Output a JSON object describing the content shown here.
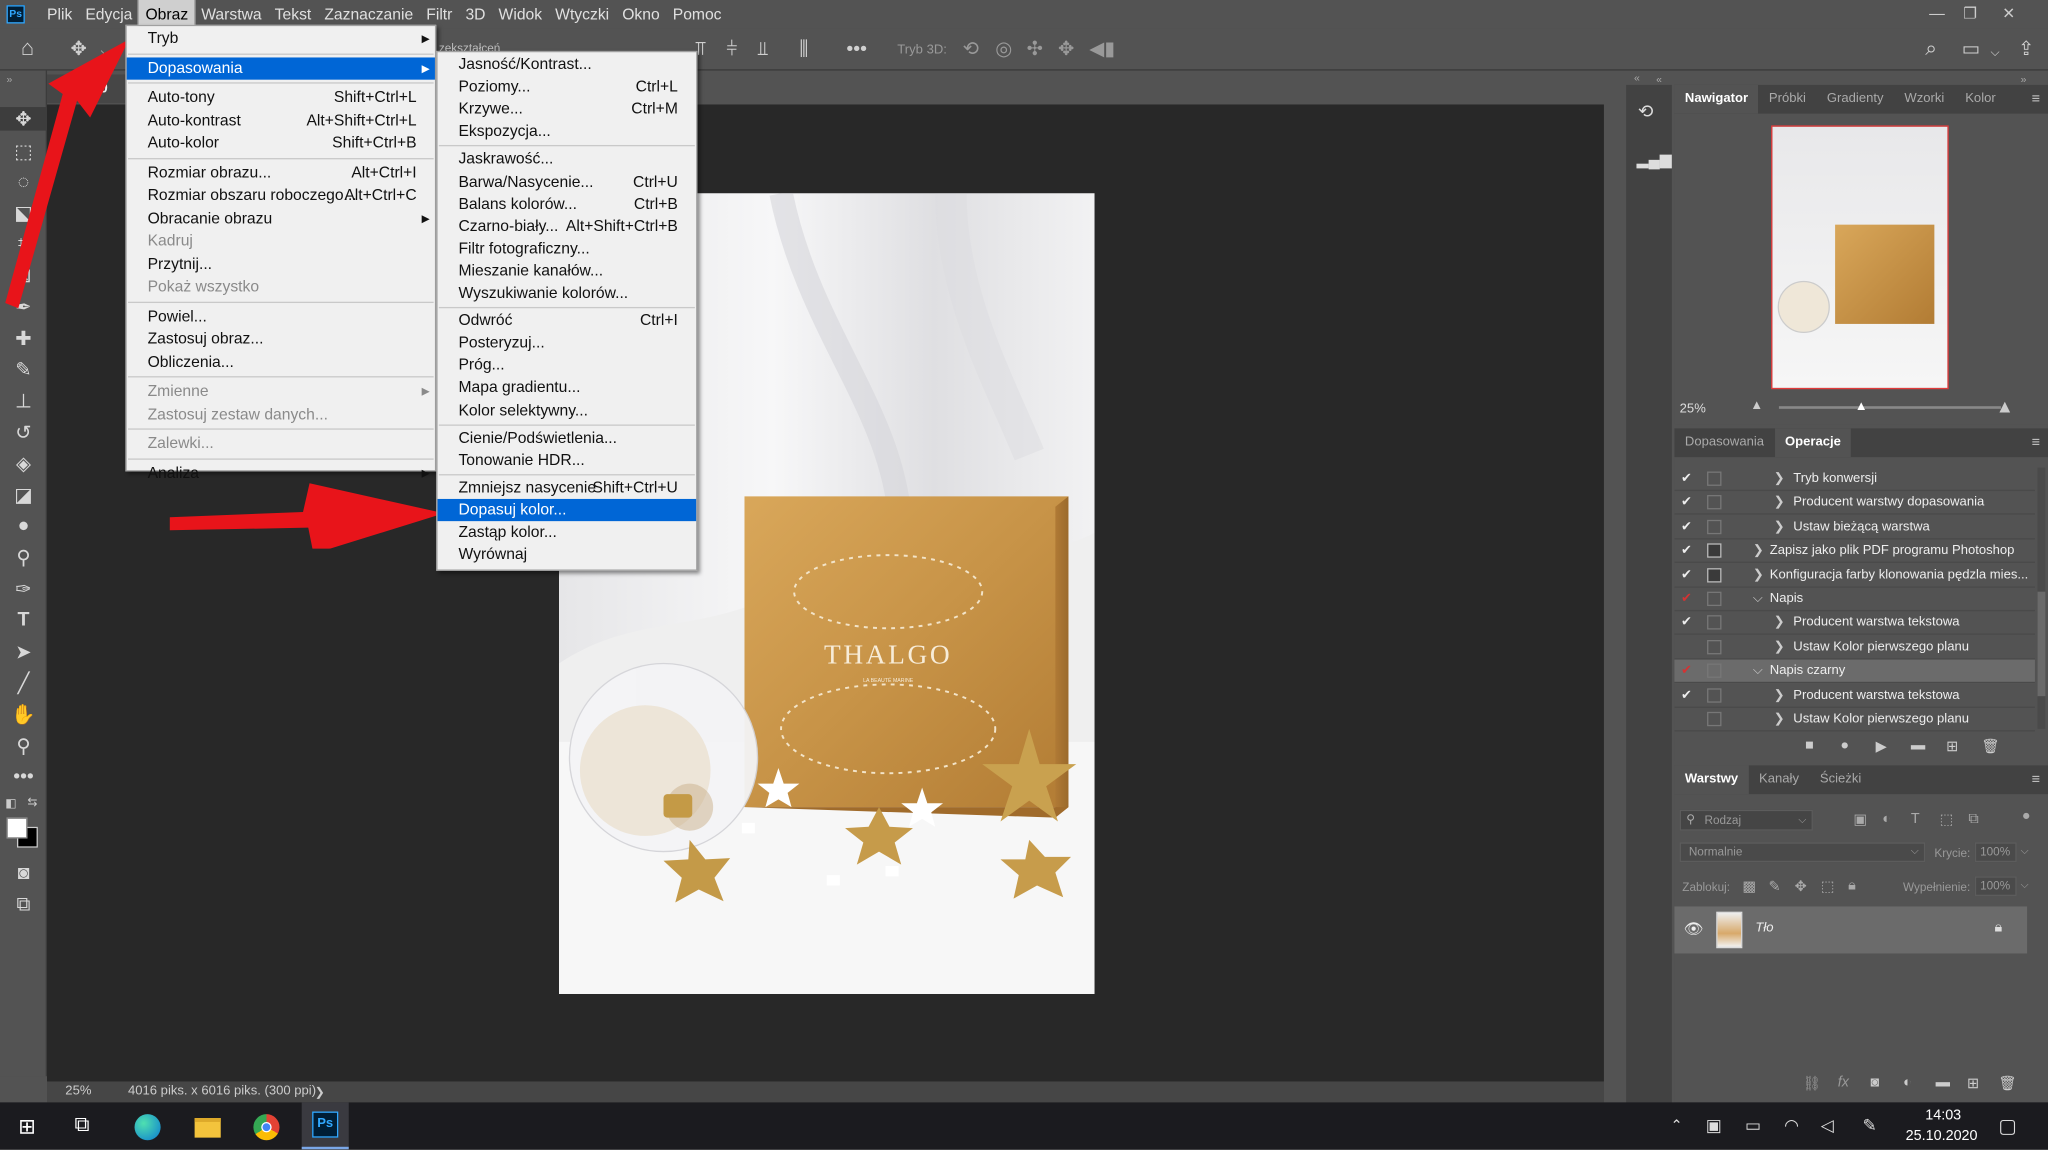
{
  "menubar": {
    "ps_logo": "Ps",
    "items": [
      "Plik",
      "Edycja",
      "Obraz",
      "Warstwa",
      "Tekst",
      "Zaznaczanie",
      "Filtr",
      "3D",
      "Widok",
      "Wtyczki",
      "Okno",
      "Pomoc"
    ],
    "active": "Obraz",
    "window_controls": [
      "—",
      "❐",
      "✕"
    ]
  },
  "optbar": {
    "partial_text": "zekształceń",
    "mode_3d_label": "Tryb 3D:"
  },
  "document": {
    "tab": "DSC_0",
    "zoom": "25%",
    "info": "4016 piks. x 6016 piks. (300 ppi)",
    "info_arrow": "❯",
    "brand": "THALGO",
    "brand_sub": "LA BEAUTÉ MARINE"
  },
  "obraz_menu": [
    {
      "label": "Tryb",
      "shortcut": "",
      "sub": true,
      "state": "normal"
    },
    {
      "sep": true
    },
    {
      "label": "Dopasowania",
      "shortcut": "",
      "sub": true,
      "state": "hl"
    },
    {
      "sep": true
    },
    {
      "label": "Auto-tony",
      "shortcut": "Shift+Ctrl+L",
      "state": "normal"
    },
    {
      "label": "Auto-kontrast",
      "shortcut": "Alt+Shift+Ctrl+L",
      "state": "normal"
    },
    {
      "label": "Auto-kolor",
      "shortcut": "Shift+Ctrl+B",
      "state": "normal"
    },
    {
      "sep": true
    },
    {
      "label": "Rozmiar obrazu...",
      "shortcut": "Alt+Ctrl+I",
      "state": "normal"
    },
    {
      "label": "Rozmiar obszaru roboczego...",
      "shortcut": "Alt+Ctrl+C",
      "state": "normal"
    },
    {
      "label": "Obracanie obrazu",
      "shortcut": "",
      "sub": true,
      "state": "normal"
    },
    {
      "label": "Kadruj",
      "shortcut": "",
      "state": "dis"
    },
    {
      "label": "Przytnij...",
      "shortcut": "",
      "state": "normal"
    },
    {
      "label": "Pokaż wszystko",
      "shortcut": "",
      "state": "dis"
    },
    {
      "sep": true
    },
    {
      "label": "Powiel...",
      "shortcut": "",
      "state": "normal"
    },
    {
      "label": "Zastosuj obraz...",
      "shortcut": "",
      "state": "normal"
    },
    {
      "label": "Obliczenia...",
      "shortcut": "",
      "state": "normal"
    },
    {
      "sep": true
    },
    {
      "label": "Zmienne",
      "shortcut": "",
      "sub": true,
      "state": "dis"
    },
    {
      "label": "Zastosuj zestaw danych...",
      "shortcut": "",
      "state": "dis"
    },
    {
      "sep": true
    },
    {
      "label": "Zalewki...",
      "shortcut": "",
      "state": "dis"
    },
    {
      "sep": true
    },
    {
      "label": "Analiza",
      "shortcut": "",
      "sub": true,
      "state": "normal"
    }
  ],
  "dopasowania_menu": [
    {
      "label": "Jasność/Kontrast...",
      "shortcut": "",
      "state": "normal"
    },
    {
      "label": "Poziomy...",
      "shortcut": "Ctrl+L",
      "state": "normal"
    },
    {
      "label": "Krzywe...",
      "shortcut": "Ctrl+M",
      "state": "normal"
    },
    {
      "label": "Ekspozycja...",
      "shortcut": "",
      "state": "normal"
    },
    {
      "sep": true
    },
    {
      "label": "Jaskrawość...",
      "shortcut": "",
      "state": "normal"
    },
    {
      "label": "Barwa/Nasycenie...",
      "shortcut": "Ctrl+U",
      "state": "normal"
    },
    {
      "label": "Balans kolorów...",
      "shortcut": "Ctrl+B",
      "state": "normal"
    },
    {
      "label": "Czarno-biały...",
      "shortcut": "Alt+Shift+Ctrl+B",
      "state": "normal"
    },
    {
      "label": "Filtr fotograficzny...",
      "shortcut": "",
      "state": "normal"
    },
    {
      "label": "Mieszanie kanałów...",
      "shortcut": "",
      "state": "normal"
    },
    {
      "label": "Wyszukiwanie kolorów...",
      "shortcut": "",
      "state": "normal"
    },
    {
      "sep": true
    },
    {
      "label": "Odwróć",
      "shortcut": "Ctrl+I",
      "state": "normal"
    },
    {
      "label": "Posteryzuj...",
      "shortcut": "",
      "state": "normal"
    },
    {
      "label": "Próg...",
      "shortcut": "",
      "state": "normal"
    },
    {
      "label": "Mapa gradientu...",
      "shortcut": "",
      "state": "normal"
    },
    {
      "label": "Kolor selektywny...",
      "shortcut": "",
      "state": "normal"
    },
    {
      "sep": true
    },
    {
      "label": "Cienie/Podświetlenia...",
      "shortcut": "",
      "state": "normal"
    },
    {
      "label": "Tonowanie HDR...",
      "shortcut": "",
      "state": "normal"
    },
    {
      "sep": true
    },
    {
      "label": "Zmniejsz nasycenie",
      "shortcut": "Shift+Ctrl+U",
      "state": "normal"
    },
    {
      "label": "Dopasuj kolor...",
      "shortcut": "",
      "state": "hl"
    },
    {
      "label": "Zastąp kolor...",
      "shortcut": "",
      "state": "normal"
    },
    {
      "label": "Wyrównaj",
      "shortcut": "",
      "state": "normal"
    }
  ],
  "navigator": {
    "tabs": [
      "Nawigator",
      "Próbki",
      "Gradienty",
      "Wzorki",
      "Kolor"
    ],
    "active": "Nawigator",
    "zoom": "25%"
  },
  "actions": {
    "tabs": [
      "Dopasowania",
      "Operacje"
    ],
    "active": "Operacje",
    "rows": [
      {
        "label": "Tryb konwersji",
        "check": "✔",
        "check_color": "#eeeeee",
        "twisty": "❯",
        "level": 2,
        "box": false,
        "selected": false
      },
      {
        "label": "Producent warstwy dopasowania",
        "check": "✔",
        "check_color": "#eeeeee",
        "twisty": "❯",
        "level": 2,
        "box": false,
        "selected": false
      },
      {
        "label": "Ustaw bieżącą warstwa",
        "check": "✔",
        "check_color": "#eeeeee",
        "twisty": "❯",
        "level": 2,
        "box": false,
        "selected": false
      },
      {
        "label": "Zapisz jako plik PDF programu Photoshop",
        "check": "✔",
        "check_color": "#eeeeee",
        "twisty": "❯",
        "level": 1,
        "box": true,
        "selected": false
      },
      {
        "label": "Konfiguracja farby klonowania pędzla mies...",
        "check": "✔",
        "check_color": "#eeeeee",
        "twisty": "❯",
        "level": 1,
        "box": true,
        "selected": false
      },
      {
        "label": "Napis",
        "check": "✔",
        "check_color": "#d33333",
        "twisty": "⌵",
        "level": 1,
        "box": false,
        "selected": false
      },
      {
        "label": "Producent warstwa tekstowa",
        "check": "✔",
        "check_color": "#eeeeee",
        "twisty": "❯",
        "level": 2,
        "box": false,
        "selected": false
      },
      {
        "label": "Ustaw Kolor pierwszego planu",
        "check": "",
        "check_color": "#eeeeee",
        "twisty": "❯",
        "level": 2,
        "box": false,
        "selected": false
      },
      {
        "label": "Napis czarny",
        "check": "✔",
        "check_color": "#d33333",
        "twisty": "⌵",
        "level": 1,
        "box": false,
        "selected": true
      },
      {
        "label": "Producent warstwa tekstowa",
        "check": "✔",
        "check_color": "#eeeeee",
        "twisty": "❯",
        "level": 2,
        "box": false,
        "selected": false
      },
      {
        "label": "Ustaw Kolor pierwszego planu",
        "check": "",
        "check_color": "#eeeeee",
        "twisty": "❯",
        "level": 2,
        "box": false,
        "selected": false
      }
    ],
    "controls": [
      "■",
      "●",
      "▶",
      "▬",
      "⊞",
      "🗑"
    ]
  },
  "layers": {
    "tabs": [
      "Warstwy",
      "Kanały",
      "Ścieżki"
    ],
    "active": "Warstwy",
    "filter_placeholder": "Rodzaj",
    "blend_mode": "Normalnie",
    "opacity_label": "Krycie:",
    "opacity_value": "100%",
    "lock_label": "Zablokuj:",
    "fill_label": "Wypełnienie:",
    "fill_value": "100%",
    "layer_name": "Tło"
  },
  "taskbar": {
    "time": "14:03",
    "date": "25.10.2020",
    "ps_label": "Ps"
  },
  "colors": {
    "highlight": "#0066d6",
    "arrow": "#e8141a"
  }
}
